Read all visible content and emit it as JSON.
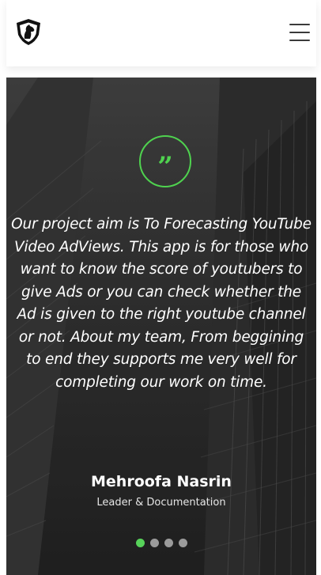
{
  "header": {
    "logo_icon": "knight-horse-shield-icon",
    "menu_icon": "hamburger-menu-icon"
  },
  "testimonial": {
    "quote_icon": "quote-icon",
    "quote_glyph": "”",
    "text": "Our project aim is To Forecasting YouTube Video AdViews. This app is for those who want to know the score of youtubers to give Ads or you can check whether the Ad is given to the right youtube channel or not. About my team, From beggining to end they supports me very well for completing our work on time.",
    "author": "Mehroofa Nasrin",
    "role": "Leader & Documentation"
  },
  "carousel": {
    "slide_count": 4,
    "active_index": 0
  },
  "colors": {
    "accent": "#57d25a",
    "hero_bg": "#333333",
    "header_bg": "#ffffff"
  }
}
